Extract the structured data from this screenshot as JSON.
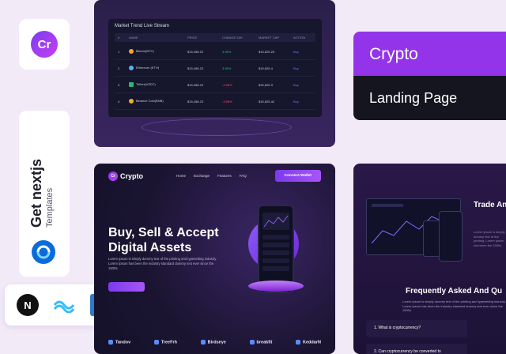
{
  "brand": {
    "logo_text": "Cr"
  },
  "sidebar": {
    "title": "Get nextjs",
    "subtitle": "Templates"
  },
  "tech_icons": [
    "nextjs-icon",
    "tailwind-icon",
    "typescript-icon",
    "react-icon",
    "window-icon",
    "figma-icon"
  ],
  "tech_labels": {
    "typescript": "TS",
    "nextjs": "N"
  },
  "title_card": {
    "line1": "Crypto",
    "line2": "Landing Page"
  },
  "market": {
    "title": "Market Trend Live Stream",
    "columns": [
      "#",
      "NAME",
      "PRICE",
      "CHANGE 24H",
      "MARKET CAP",
      "ACTION"
    ],
    "rows": [
      {
        "n": "1",
        "name": "Bitcoin(BTC)",
        "price": "$15,458.23",
        "change": "3.96%",
        "cap": "$15,625.25",
        "action": "Buy",
        "dir": "up"
      },
      {
        "n": "2",
        "name": "Ethereum (ETH)",
        "price": "$15,458.23",
        "change": "3.96%",
        "cap": "$15,625.4",
        "action": "Buy",
        "dir": "up"
      },
      {
        "n": "3",
        "name": "Tether(USDT)",
        "price": "$15,458.23",
        "change": "-3.96%",
        "cap": "$15,625.3",
        "action": "Buy",
        "dir": "down"
      },
      {
        "n": "4",
        "name": "Binance Coin(BNB)",
        "price": "$15,458.23",
        "change": "-3.96%",
        "cap": "$15,625.42",
        "action": "Buy",
        "dir": "down"
      }
    ]
  },
  "landing": {
    "logo": "Crypto",
    "logo_mark": "Cr",
    "nav": [
      "Home",
      "Exchange",
      "Features",
      "FAQ"
    ],
    "cta": "Connect Wallet",
    "headline": "Buy, Sell & Accept Digital Assets",
    "body": "Lorem Ipsum is simply dummy text of the printing and typesetting industry. Lorem Ipsum has been the industry standard dummy text ever since the 1500s.",
    "partners": [
      "Tandov",
      "TreeFrh",
      "Birdseye",
      "breakfit",
      "KeddarN"
    ]
  },
  "right_card": {
    "heading": "Trade An Any tim",
    "body": "Lorem ipsum is simply dummy text of the printing. Lorem ipsum has been the 1500s.",
    "faq_title": "Frequently Asked And Qu",
    "faq_body": "Lorem ipsum is simply dummy text of the printing and typesetting industry. Lorem ipsum has been the industry standard dummy text ever since the 1500s.",
    "faq_items": [
      "1. What is cryptocurrency?",
      "2. Can cryptocurrency be converted to"
    ]
  },
  "colors": {
    "accent": "#9333ea",
    "dark": "#151520",
    "background": "#f3eaf8"
  }
}
